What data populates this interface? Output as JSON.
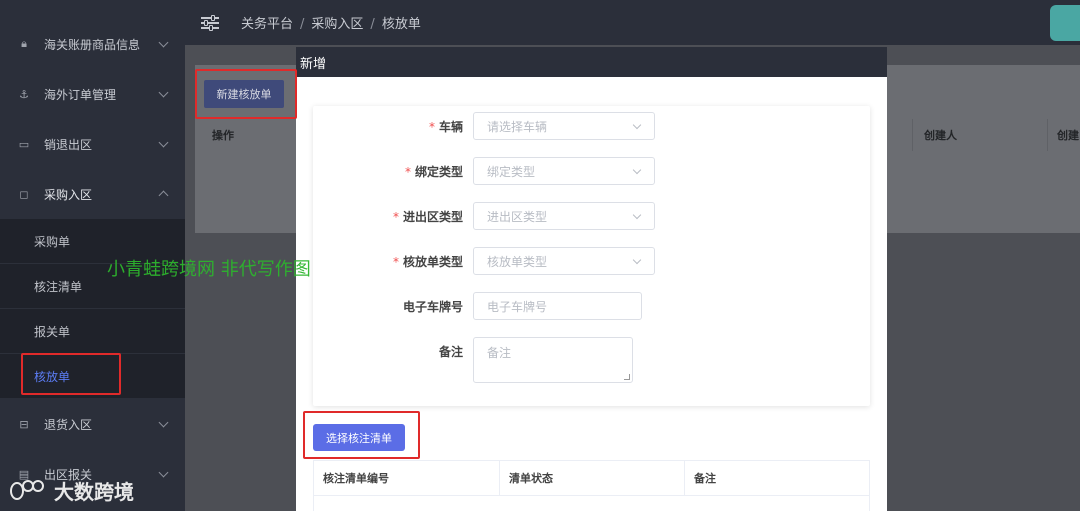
{
  "sidebar": {
    "items": [
      {
        "label": "海关账册商品信息",
        "icon": "lock-icon"
      },
      {
        "label": "海外订单管理",
        "icon": "anchor-icon"
      },
      {
        "label": "销退出区",
        "icon": "card-icon"
      },
      {
        "label": "采购入区",
        "icon": "square-icon"
      },
      {
        "label": "退货入区",
        "icon": "return-icon"
      },
      {
        "label": "出区报关",
        "icon": "document-icon"
      }
    ],
    "subitems": [
      {
        "label": "采购单"
      },
      {
        "label": "核注清单"
      },
      {
        "label": "报关单"
      },
      {
        "label": "核放单"
      }
    ]
  },
  "header": {
    "breadcrumb": [
      "关务平台",
      "采购入区",
      "核放单"
    ],
    "sep": "/"
  },
  "page": {
    "new_button": "新建核放单",
    "columns": [
      "操作",
      "创建人",
      "创建"
    ]
  },
  "modal": {
    "title": "新增",
    "fields": [
      {
        "label": "车辆",
        "required": true,
        "placeholder": "请选择车辆"
      },
      {
        "label": "绑定类型",
        "required": true,
        "placeholder": "绑定类型"
      },
      {
        "label": "进出区类型",
        "required": true,
        "placeholder": "进出区类型"
      },
      {
        "label": "核放单类型",
        "required": true,
        "placeholder": "核放单类型"
      },
      {
        "label": "电子车牌号",
        "required": false,
        "placeholder": "电子车牌号"
      },
      {
        "label": "备注",
        "required": false,
        "placeholder": "备注"
      }
    ],
    "required_mark": "*",
    "select_button": "选择核注清单",
    "table_columns": [
      "核注清单编号",
      "清单状态",
      "备注"
    ]
  },
  "watermark": {
    "text": "小青蛙跨境网 非代写作图",
    "logo_text": "大数跨境"
  },
  "colors": {
    "sidebar_bg": "#2b2f3a",
    "accent": "#5b6de6",
    "active_item": "#5b7cf3",
    "highlight": "#e02a2a"
  }
}
